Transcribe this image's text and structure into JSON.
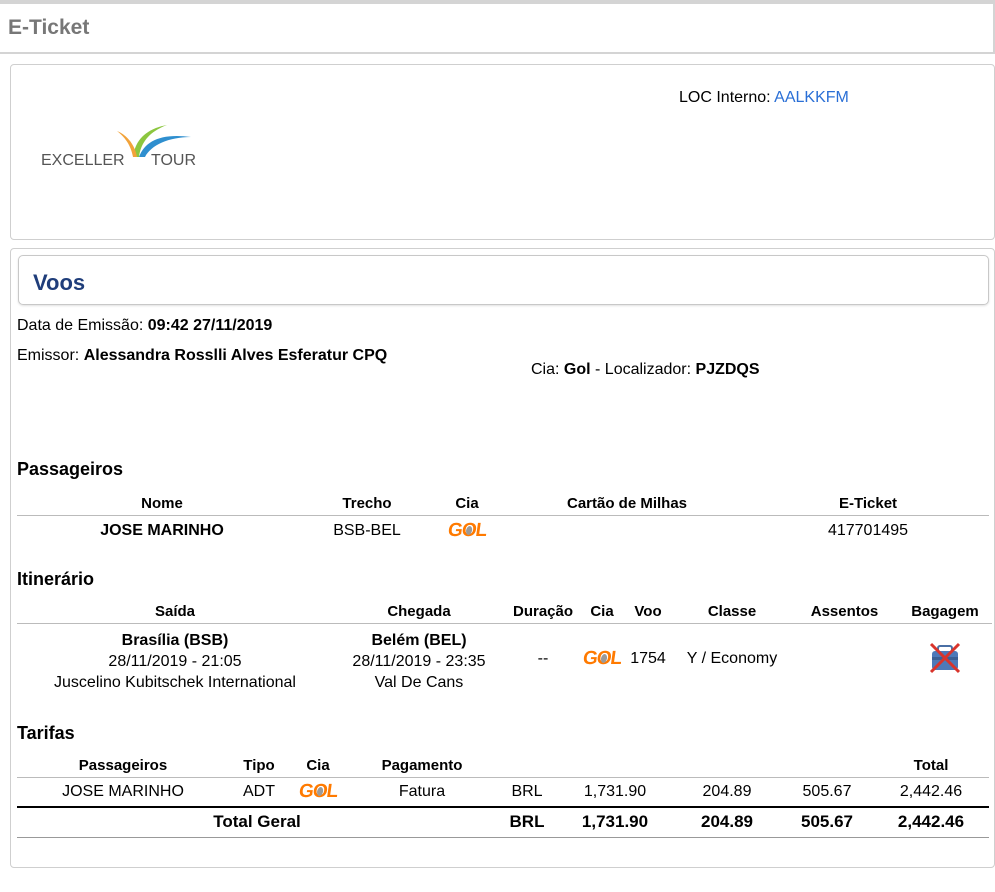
{
  "header": {
    "title": "E-Ticket"
  },
  "top": {
    "loc_label": "LOC Interno:",
    "loc_code": "AALKKFM",
    "logo_text_left": "EXCELLER",
    "logo_text_right": "TOUR"
  },
  "voos": {
    "title": "Voos",
    "emissao_label": "Data de Emissão:",
    "emissao_value": "09:42 27/11/2019",
    "emissor_label": "Emissor:",
    "emissor_value": "Alessandra Rosslli Alves Esferatur CPQ",
    "cia_label": "Cia:",
    "cia_value": "Gol",
    "localizador_label": "- Localizador:",
    "localizador_value": "PJZDQS"
  },
  "airline_logo": {
    "text_g": "G",
    "text_o": "O",
    "text_l": "L",
    "color": "#ff7a00"
  },
  "passageiros": {
    "title": "Passageiros",
    "headers": [
      "Nome",
      "Trecho",
      "Cia",
      "Cartão de Milhas",
      "E-Ticket"
    ],
    "rows": [
      {
        "nome": "JOSE MARINHO",
        "trecho": "BSB-BEL",
        "cartao": "",
        "eticket": "417701495"
      }
    ]
  },
  "itinerario": {
    "title": "Itinerário",
    "headers": [
      "Saída",
      "Chegada",
      "Duração",
      "Cia",
      "Voo",
      "Classe",
      "Assentos",
      "Bagagem"
    ],
    "rows": [
      {
        "saida_city": "Brasília (BSB)",
        "saida_datetime": "28/11/2019 - 21:05",
        "saida_airport": "Juscelino Kubitschek International",
        "chegada_city": "Belém (BEL)",
        "chegada_datetime": "28/11/2019 - 23:35",
        "chegada_airport": "Val De Cans",
        "duracao": "--",
        "voo": "1754",
        "classe": "Y / Economy",
        "assentos": "",
        "bagagem_icon": "no-baggage-icon"
      }
    ]
  },
  "tarifas": {
    "title": "Tarifas",
    "headers": [
      "Passageiros",
      "Tipo",
      "Cia",
      "Pagamento",
      "",
      "",
      "",
      "",
      "Total"
    ],
    "rows": [
      {
        "passageiro": "JOSE MARINHO",
        "tipo": "ADT",
        "pagamento": "Fatura",
        "moeda": "BRL",
        "tarifa": "1,731.90",
        "taxa1": "204.89",
        "taxa2": "505.67",
        "total": "2,442.46"
      }
    ],
    "total_geral": {
      "label": "Total Geral",
      "moeda": "BRL",
      "tarifa": "1,731.90",
      "taxa1": "204.89",
      "taxa2": "505.67",
      "total": "2,442.46"
    }
  }
}
